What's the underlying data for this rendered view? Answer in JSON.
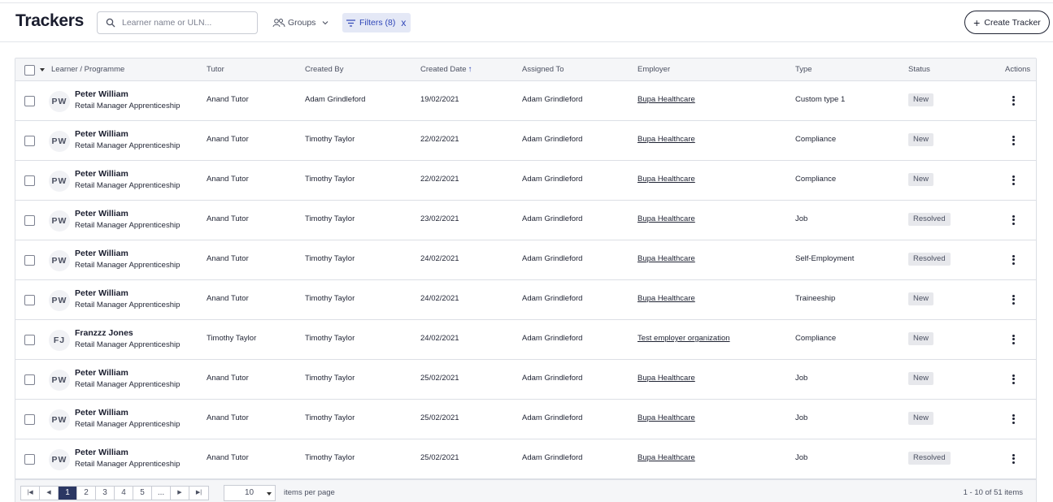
{
  "header": {
    "title": "Trackers",
    "search_placeholder": "Learner name or ULN...",
    "groups_label": "Groups",
    "filters_label": "Filters (8)",
    "filters_clear": "x",
    "create_label": "Create Tracker",
    "create_plus": "+"
  },
  "columns": {
    "learner": "Learner / Programme",
    "tutor": "Tutor",
    "created_by": "Created By",
    "created_date": "Created Date",
    "sort_arrow": "↑",
    "assigned_to": "Assigned To",
    "employer": "Employer",
    "type": "Type",
    "status": "Status",
    "actions": "Actions"
  },
  "rows": [
    {
      "initials": "PW",
      "name": "Peter William",
      "programme": "Retail Manager Apprenticeship",
      "tutor": "Anand Tutor",
      "created_by": "Adam Grindleford",
      "created_date": "19/02/2021",
      "assigned_to": "Adam Grindleford",
      "employer": "Bupa Healthcare",
      "type": "Custom type 1",
      "status": "New"
    },
    {
      "initials": "PW",
      "name": "Peter William",
      "programme": "Retail Manager Apprenticeship",
      "tutor": "Anand Tutor",
      "created_by": "Timothy Taylor",
      "created_date": "22/02/2021",
      "assigned_to": "Adam Grindleford",
      "employer": "Bupa Healthcare",
      "type": "Compliance",
      "status": "New"
    },
    {
      "initials": "PW",
      "name": "Peter William",
      "programme": "Retail Manager Apprenticeship",
      "tutor": "Anand Tutor",
      "created_by": "Timothy Taylor",
      "created_date": "22/02/2021",
      "assigned_to": "Adam Grindleford",
      "employer": "Bupa Healthcare",
      "type": "Compliance",
      "status": "New"
    },
    {
      "initials": "PW",
      "name": "Peter William",
      "programme": "Retail Manager Apprenticeship",
      "tutor": "Anand Tutor",
      "created_by": "Timothy Taylor",
      "created_date": "23/02/2021",
      "assigned_to": "Adam Grindleford",
      "employer": "Bupa Healthcare",
      "type": "Job",
      "status": "Resolved"
    },
    {
      "initials": "PW",
      "name": "Peter William",
      "programme": "Retail Manager Apprenticeship",
      "tutor": "Anand Tutor",
      "created_by": "Timothy Taylor",
      "created_date": "24/02/2021",
      "assigned_to": "Adam Grindleford",
      "employer": "Bupa Healthcare",
      "type": "Self-Employment",
      "status": "Resolved"
    },
    {
      "initials": "PW",
      "name": "Peter William",
      "programme": "Retail Manager Apprenticeship",
      "tutor": "Anand Tutor",
      "created_by": "Timothy Taylor",
      "created_date": "24/02/2021",
      "assigned_to": "Adam Grindleford",
      "employer": "Bupa Healthcare",
      "type": "Traineeship",
      "status": "New"
    },
    {
      "initials": "FJ",
      "name": "Franzzz Jones",
      "programme": "Retail Manager Apprenticeship",
      "tutor": "Timothy Taylor",
      "created_by": "Timothy Taylor",
      "created_date": "24/02/2021",
      "assigned_to": "Adam Grindleford",
      "employer": "Test employer organization",
      "type": "Compliance",
      "status": "New"
    },
    {
      "initials": "PW",
      "name": "Peter William",
      "programme": "Retail Manager Apprenticeship",
      "tutor": "Anand Tutor",
      "created_by": "Timothy Taylor",
      "created_date": "25/02/2021",
      "assigned_to": "Adam Grindleford",
      "employer": "Bupa Healthcare",
      "type": "Job",
      "status": "New"
    },
    {
      "initials": "PW",
      "name": "Peter William",
      "programme": "Retail Manager Apprenticeship",
      "tutor": "Anand Tutor",
      "created_by": "Timothy Taylor",
      "created_date": "25/02/2021",
      "assigned_to": "Adam Grindleford",
      "employer": "Bupa Healthcare",
      "type": "Job",
      "status": "New"
    },
    {
      "initials": "PW",
      "name": "Peter William",
      "programme": "Retail Manager Apprenticeship",
      "tutor": "Anand Tutor",
      "created_by": "Timothy Taylor",
      "created_date": "25/02/2021",
      "assigned_to": "Adam Grindleford",
      "employer": "Bupa Healthcare",
      "type": "Job",
      "status": "Resolved"
    }
  ],
  "pagination": {
    "pages": [
      "1",
      "2",
      "3",
      "4",
      "5",
      "..."
    ],
    "current": "1",
    "page_size": "10",
    "per_page_label": "items per page",
    "range_label": "1 - 10 of 51 items"
  },
  "colors": {
    "accent": "#2f46b8",
    "active_page": "#2b3763",
    "badge_bg": "#e7e8ec"
  }
}
